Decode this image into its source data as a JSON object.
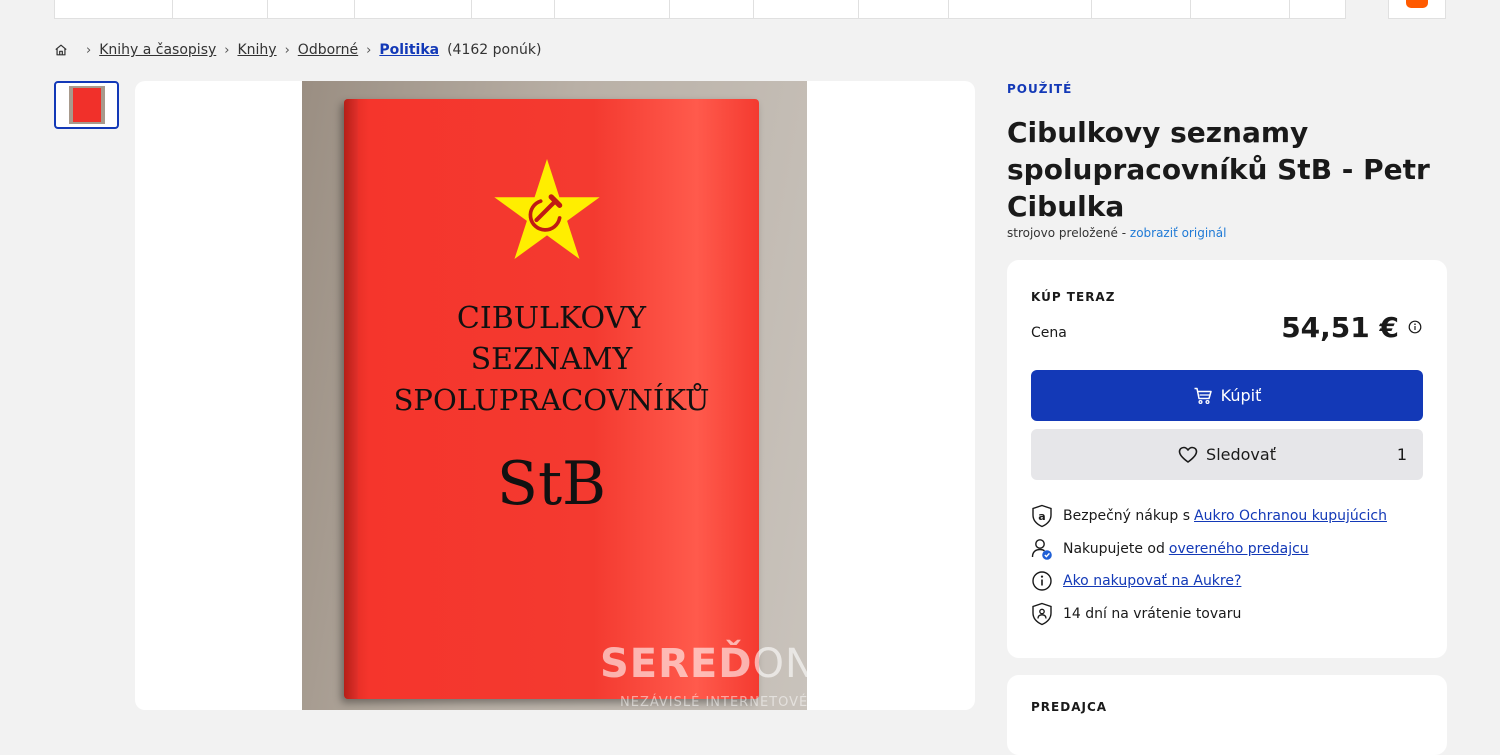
{
  "breadcrumb": {
    "items": [
      "Knihy a časopisy",
      "Knihy",
      "Odborné"
    ],
    "current": "Politika",
    "count": "(4162 ponúk)"
  },
  "cover": {
    "line1": "CIBULKOVY",
    "line2": "SEZNAMY",
    "line3": "SPOLUPRACOVNÍKŮ",
    "line4": "StB",
    "watermark_bold": "SEREĎ",
    "watermark_light": "ON",
    "watermark_sub": "NEZÁVISLÉ INTERNETOVÉ"
  },
  "product": {
    "condition": "POUŽITÉ",
    "title": "Cibulkovy seznamy spolupracovníků StB - Petr Cibulka",
    "translated_note": "strojovo preložené -",
    "show_original": "zobraziť originál"
  },
  "buy": {
    "label": "KÚP TERAZ",
    "price_label": "Cena",
    "price": "54,51 €",
    "buy_button": "Kúpiť",
    "watch_button": "Sledovať",
    "watch_count": "1"
  },
  "perks": {
    "p1_text": "Bezpečný nákup s",
    "p1_link": "Aukro Ochranou kupujúcich",
    "p2_text": "Nakupujete od",
    "p2_link": "overeného predajcu",
    "p3_link": "Ako nakupovať na Aukre?",
    "p4_text": "14 dní na vrátenie tovaru"
  },
  "seller": {
    "label": "PREDAJCA"
  },
  "colors": {
    "accent": "#1339b7",
    "brand_orange": "#ff5a00",
    "link_light": "#1f7ad6"
  },
  "icons": [
    "home-icon",
    "cart-icon",
    "heart-icon",
    "aukro-shield-icon",
    "verified-user-icon",
    "info-icon",
    "return-shield-icon"
  ]
}
